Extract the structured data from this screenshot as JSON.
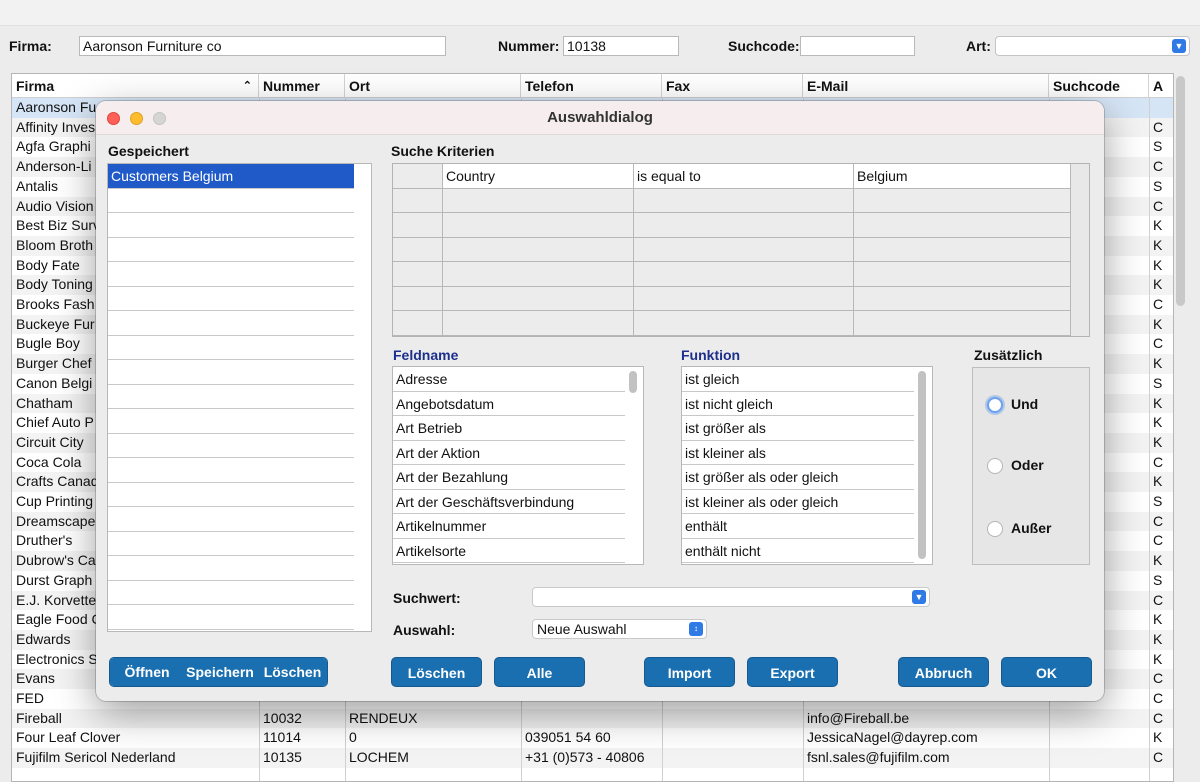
{
  "header": {
    "firma_label": "Firma:",
    "firma_value": "Aaronson Furniture co",
    "nummer_label": "Nummer:",
    "nummer_value": "10138",
    "suchcode_label": "Suchcode:",
    "suchcode_value": "",
    "art_label": "Art:",
    "art_value": ""
  },
  "table": {
    "columns": [
      "Firma",
      "Nummer",
      "Ort",
      "Telefon",
      "Fax",
      "E-Mail",
      "Suchcode",
      "A"
    ],
    "rows": [
      {
        "firma": "Aaronson Fu",
        "art": ""
      },
      {
        "firma": "Affinity Inves",
        "art": "C"
      },
      {
        "firma": "Agfa Graphi",
        "art": "S"
      },
      {
        "firma": "Anderson-Li",
        "art": "C"
      },
      {
        "firma": "Antalis",
        "art": "S"
      },
      {
        "firma": "Audio Vision",
        "art": "C"
      },
      {
        "firma": "Best Biz Surv",
        "art": "K"
      },
      {
        "firma": "Bloom Broth",
        "art": "K"
      },
      {
        "firma": "Body Fate",
        "art": "K"
      },
      {
        "firma": "Body Toning",
        "art": "K"
      },
      {
        "firma": "Brooks Fash",
        "art": "C"
      },
      {
        "firma": "Buckeye Fur",
        "art": "K"
      },
      {
        "firma": "Bugle Boy",
        "art": "C"
      },
      {
        "firma": "Burger Chef",
        "art": "K"
      },
      {
        "firma": "Canon Belgi",
        "art": "S"
      },
      {
        "firma": "Chatham",
        "art": "K"
      },
      {
        "firma": "Chief Auto P",
        "art": "K"
      },
      {
        "firma": "Circuit City",
        "art": "K"
      },
      {
        "firma": "Coca Cola",
        "art": "C"
      },
      {
        "firma": "Crafts Canad",
        "art": "K"
      },
      {
        "firma": "Cup Printing",
        "art": "S"
      },
      {
        "firma": "Dreamscape",
        "art": "C"
      },
      {
        "firma": "Druther's",
        "art": "C"
      },
      {
        "firma": "Dubrow's Ca",
        "art": "K"
      },
      {
        "firma": "Durst Graph",
        "art": "S"
      },
      {
        "firma": "E.J. Korvette",
        "art": "C"
      },
      {
        "firma": "Eagle Food C",
        "art": "K"
      },
      {
        "firma": "Edwards",
        "art": "K"
      },
      {
        "firma": "Electronics S",
        "art": "K"
      },
      {
        "firma": "Evans",
        "art": "C"
      },
      {
        "firma": "FED",
        "art": "C"
      },
      {
        "firma": "Fireball",
        "nummer": "10032",
        "ort": "RENDEUX",
        "telefon": "",
        "email": "info@Fireball.be",
        "art": "C"
      },
      {
        "firma": "Four Leaf Clover",
        "nummer": "11014",
        "ort": "0",
        "telefon": "039051 54 60",
        "email": "JessicaNagel@dayrep.com",
        "art": "K"
      },
      {
        "firma": "Fujifilm Sericol Nederland",
        "nummer": "10135",
        "ort": "LOCHEM",
        "telefon": "+31 (0)573 - 40806",
        "email": "fsnl.sales@fujifilm.com",
        "art": "C"
      }
    ]
  },
  "dialog": {
    "title": "Auswahldialog",
    "gespeichert_label": "Gespeichert",
    "saved_items": [
      "Customers Belgium"
    ],
    "suche_label": "Suche Kriterien",
    "criteria": [
      {
        "field": "Country",
        "operator": "is equal to",
        "value": "Belgium"
      }
    ],
    "feldname_label": "Feldname",
    "feldnamen": [
      "Adresse",
      "Angebotsdatum",
      "Art Betrieb",
      "Art der Aktion",
      "Art der Bezahlung",
      "Art der Geschäftsverbindung",
      "Artikelnummer",
      "Artikelsorte"
    ],
    "funktion_label": "Funktion",
    "funktionen": [
      "ist gleich",
      "ist nicht gleich",
      "ist größer als",
      "ist kleiner als",
      "ist größer als oder gleich",
      "ist kleiner als oder gleich",
      "enthält",
      "enthält nicht"
    ],
    "zusaetzlich_label": "Zusätzlich",
    "radios": [
      "Und",
      "Oder",
      "Außer"
    ],
    "suchwert_label": "Suchwert:",
    "suchwert_value": "",
    "auswahl_label": "Auswahl:",
    "auswahl_value": "Neue Auswahl",
    "buttons": {
      "oeffnen": "Öffnen",
      "speichern": "Speichern",
      "loeschen_saved": "Löschen",
      "loeschen": "Löschen",
      "alle": "Alle",
      "import": "Import",
      "export": "Export",
      "abbruch": "Abbruch",
      "ok": "OK"
    }
  },
  "colors": {
    "accent_button": "#1a6fb0",
    "selection": "#1f5ac8",
    "label_blue": "#1c2f8c"
  }
}
